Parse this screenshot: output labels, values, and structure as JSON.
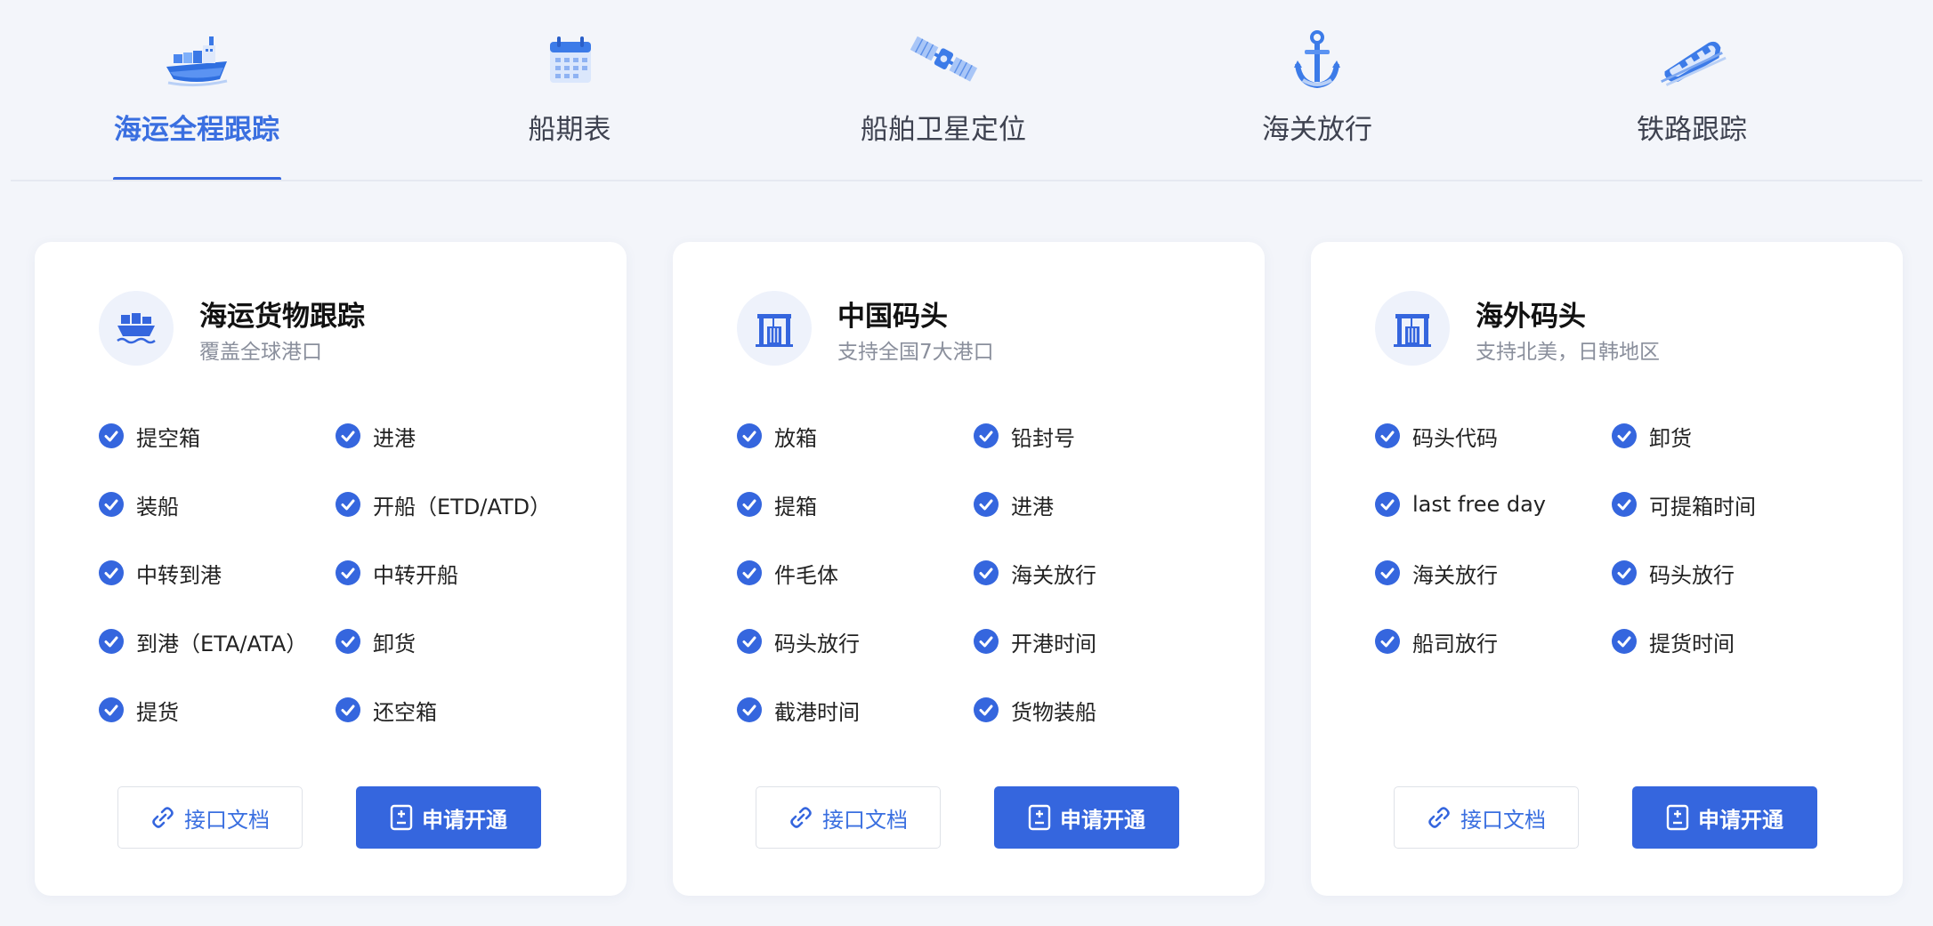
{
  "tabs": [
    {
      "label": "海运全程跟踪",
      "icon": "cargo-ship-icon",
      "active": true
    },
    {
      "label": "船期表",
      "icon": "calendar-icon",
      "active": false
    },
    {
      "label": "船舶卫星定位",
      "icon": "satellite-icon",
      "active": false
    },
    {
      "label": "海关放行",
      "icon": "anchor-icon",
      "active": false
    },
    {
      "label": "铁路跟踪",
      "icon": "train-icon",
      "active": false
    }
  ],
  "colors": {
    "accent": "#3566de",
    "active_tab_text": "#3a6fe0",
    "check": "#3566de",
    "page_bg": "#f3f5fa",
    "card_bg": "#ffffff"
  },
  "cards": [
    {
      "title": "海运货物跟踪",
      "subtitle": "覆盖全球港口",
      "icon": "container-ship-icon",
      "features": [
        "提空箱",
        "进港",
        "装船",
        "开船（ETD/ATD）",
        "中转到港",
        "中转开船",
        "到港（ETA/ATA）",
        "卸货",
        "提货",
        "还空箱"
      ],
      "doc_button": "接口文档",
      "apply_button": "申请开通"
    },
    {
      "title": "中国码头",
      "subtitle": "支持全国7大港口",
      "icon": "port-crane-icon",
      "features": [
        "放箱",
        "铅封号",
        "提箱",
        "进港",
        "件毛体",
        "海关放行",
        "码头放行",
        "开港时间",
        "截港时间",
        "货物装船"
      ],
      "doc_button": "接口文档",
      "apply_button": "申请开通"
    },
    {
      "title": "海外码头",
      "subtitle": "支持北美，日韩地区",
      "icon": "port-crane-icon",
      "features": [
        "码头代码",
        "卸货",
        "last free day",
        "可提箱时间",
        "海关放行",
        "码头放行",
        "船司放行",
        "提货时间"
      ],
      "doc_button": "接口文档",
      "apply_button": "申请开通"
    }
  ]
}
